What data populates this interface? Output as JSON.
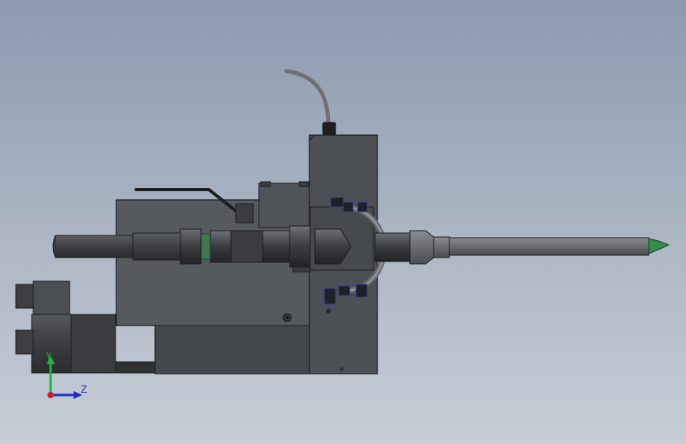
{
  "triad": {
    "y_label": "Y",
    "z_label": "Z",
    "y_color": "#21b536",
    "z_color": "#1f2fc8",
    "origin_color": "#c8202a"
  },
  "colors": {
    "body_dark": "#4a4d51",
    "body_mid": "#5a5d62",
    "edge": "#1c1d20",
    "cable": "#707276",
    "nozzle_tip": "#2f8f4a",
    "fitting_blue": "#3a3a9a"
  }
}
